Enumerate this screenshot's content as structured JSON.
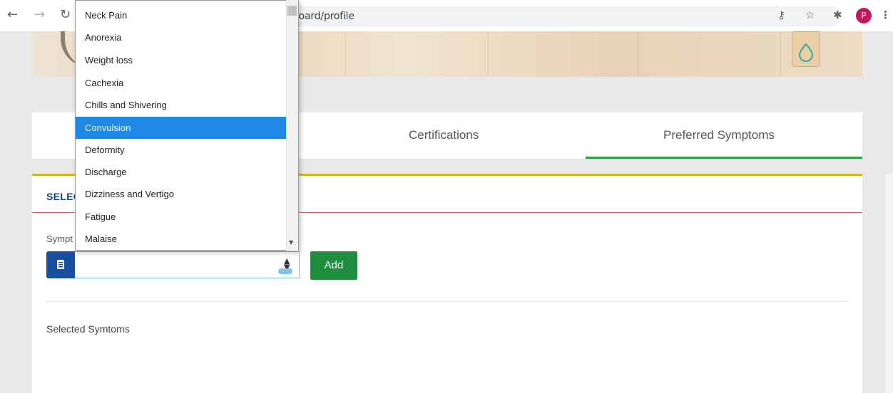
{
  "browser": {
    "url_fragment": "board/profile"
  },
  "profile": {
    "avatar_letter": "P",
    "avatar_color": "#c2185b"
  },
  "tabs": [
    {
      "label": "Certifications"
    },
    {
      "label": "Preferred Symptoms",
      "active": true
    }
  ],
  "section": {
    "title": "SELEC",
    "field_label": "Sympt",
    "select_value": "",
    "add_label": "Add",
    "selected_label": "Selected Symtoms"
  },
  "dropdown": {
    "options": [
      "Neck Pain",
      "Anorexia",
      "Weight loss",
      "Cachexia",
      "Chills and Shivering",
      "Convulsion",
      "Deformity",
      "Discharge",
      "Dizziness and Vertigo",
      "Fatigue",
      "Malaise"
    ],
    "highlighted": "Convulsion"
  },
  "colors": {
    "accent_blue": "#1a4fa0",
    "add_green": "#1e8e3e",
    "tab_underline": "#2aa04a",
    "section_border": "#d4b21a",
    "highlight": "#1e88e5"
  },
  "icons": {
    "back": "back-arrow-icon",
    "forward": "forward-arrow-icon",
    "reload": "reload-icon",
    "key": "key-icon",
    "star": "star-icon",
    "extensions": "puzzle-icon",
    "menu": "kebab-menu-icon",
    "calendar": "calendar-icon"
  }
}
